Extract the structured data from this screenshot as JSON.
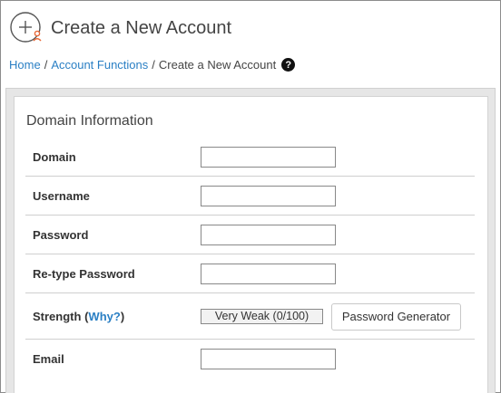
{
  "header": {
    "title": "Create a New Account",
    "icon": "add-account-icon"
  },
  "breadcrumb": {
    "items": [
      "Home",
      "Account Functions",
      "Create a New Account"
    ],
    "separator": "/",
    "help_icon": "question-circle-icon",
    "help_glyph": "?"
  },
  "form": {
    "section_title": "Domain Information",
    "fields": {
      "domain": {
        "label": "Domain",
        "value": ""
      },
      "username": {
        "label": "Username",
        "value": ""
      },
      "password": {
        "label": "Password",
        "value": ""
      },
      "retype_password": {
        "label": "Re-type Password",
        "value": ""
      },
      "strength": {
        "label": "Strength",
        "open_paren": "(",
        "why_link": "Why?",
        "close_paren": ")",
        "meter_text": "Very Weak (0/100)"
      },
      "email": {
        "label": "Email",
        "value": ""
      }
    },
    "password_generator_label": "Password Generator"
  },
  "colors": {
    "link": "#2a7fc4",
    "icon_accent": "#e86a3a",
    "panel_bg": "#e6e6e6"
  }
}
